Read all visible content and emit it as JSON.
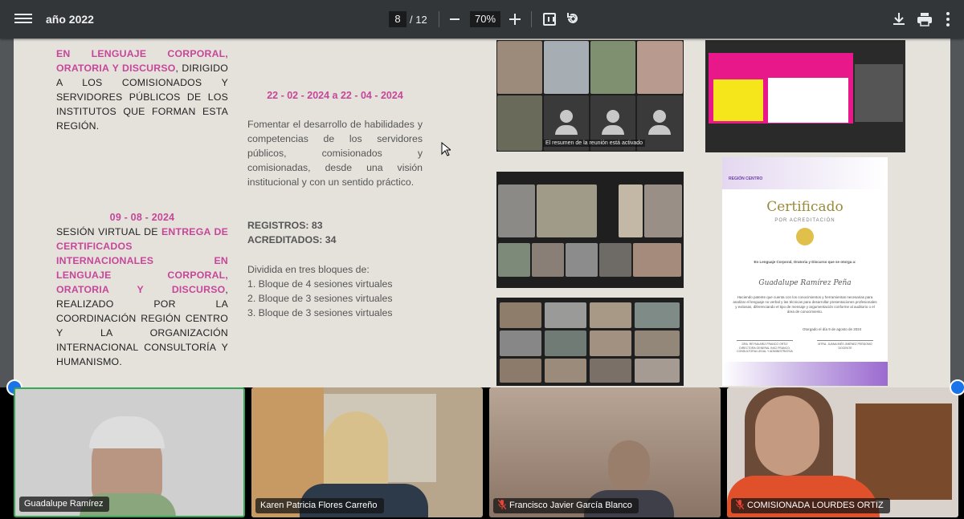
{
  "toolbar": {
    "doc_title": "año 2022",
    "current_page": "8",
    "page_total": "/ 12",
    "zoom": "70%"
  },
  "page": {
    "left_block1": {
      "pink_part": "EN LENGUAJE CORPORAL, ORATORIA Y DISCURSO",
      "black_part": ", DIRIGIDO A LOS COMISIONADOS Y SERVIDORES PÚBLICOS DE LOS INSTITUTOS QUE FORMAN ESTA REGIÓN."
    },
    "left_block2": {
      "date": "09 - 08 - 2024",
      "black_intro": "SESIÓN VIRTUAL DE ",
      "pink_part": "ENTREGA DE CERTIFICADOS INTERNACIONALES EN LENGUAJE CORPORAL, ORATORIA Y DISCURSO",
      "black_part": ", REALIZADO POR LA COORDINACIÓN REGIÓN CENTRO Y LA ORGANIZACIÓN INTERNACIONAL CONSULTORÍA Y HUMANISMO."
    },
    "middle": {
      "date_range": "22 - 02 - 2024 a 22 - 04 - 2024",
      "description": "Fomentar el desarrollo de habilidades y competencias de los servidores públicos, comisionados y comisionadas, desde una visión institucional y con un sentido práctico.",
      "registros": "REGISTROS: 83",
      "acreditados": "ACREDITADOS: 34",
      "blocks_intro": "Dividida en tres bloques de:",
      "blocks": [
        "1. Bloque de 4 sesiones virtuales",
        "2. Bloque de 3 sesiones virtuales",
        "3. Bloque de 3 sesiones virtuales"
      ]
    },
    "photo1_caption": "El resumen de la reunión está activado",
    "certificate": {
      "title": "Certificado",
      "subtitle": "POR ACREDITACIÓN",
      "course": "En Lenguaje Corporal, Oratoria y Discurso que se otorga a:",
      "name": "Guadalupe Ramírez Peña",
      "body": "Haciendo patente que cuenta con los conocimientos y herramientas necesarias para analizar el lenguaje no verbal y las técnicas para desarrollar presentaciones profesionales y exitosas, diferenciando el tipo de mensaje y argumentación conforme al auditorio o el área de conocimiento.",
      "date": "Otorgado el día 9 de agosto de 2024",
      "sig1": "DRA. REYNA ARIZ FRANCO ORTIZ DIRECTORA GENERAL INICI FRANCO, CONSULTORIA LEGAL Y ADMINISTRATIVA",
      "sig2": "MTRA. JUANA INÉS JIMÉNEZ PERDOMO DOCENTE",
      "logo_text": "REGIÓN CENTRO"
    }
  },
  "participants": [
    {
      "name": "Guadalupe Ramírez",
      "muted": false,
      "active": true
    },
    {
      "name": "Karen Patricia Flores Carreño",
      "muted": false,
      "active": false
    },
    {
      "name": "Francisco Javier García Blanco",
      "muted": true,
      "active": false
    },
    {
      "name": "COMISIONADA LOURDES ORTIZ",
      "muted": true,
      "active": false
    }
  ],
  "colors": {
    "toolbar": "#323639",
    "page_bg": "#e5e2dc",
    "accent_pink": "#c6479a",
    "active_speaker": "#34a853"
  }
}
